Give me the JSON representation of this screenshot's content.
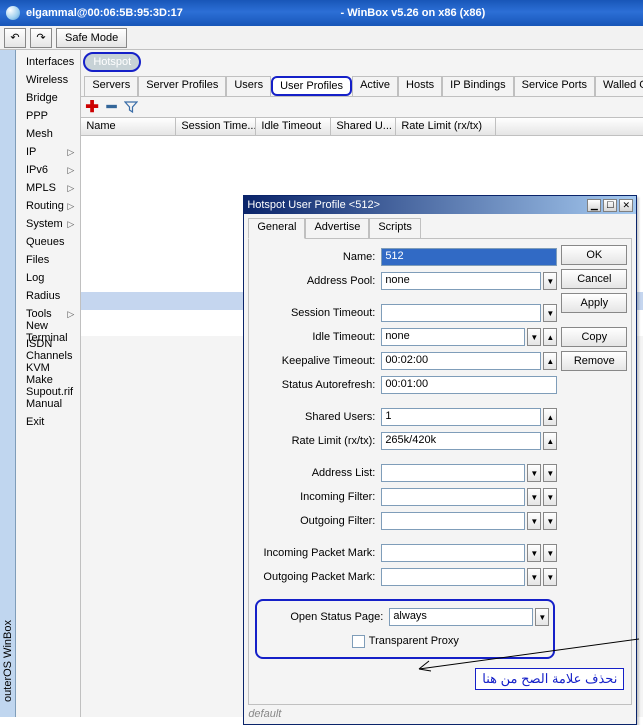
{
  "titlebar": {
    "user": "elgammal@00:06:5B:95:3D:17",
    "app": "- WinBox v5.26 on x86 (x86)"
  },
  "toolbar": {
    "safe_mode": "Safe Mode"
  },
  "side_label": "outerOS WinBox",
  "sidebar": {
    "items": [
      {
        "label": "Interfaces",
        "sub": false
      },
      {
        "label": "Wireless",
        "sub": false
      },
      {
        "label": "Bridge",
        "sub": false
      },
      {
        "label": "PPP",
        "sub": false
      },
      {
        "label": "Mesh",
        "sub": false
      },
      {
        "label": "IP",
        "sub": true
      },
      {
        "label": "IPv6",
        "sub": true
      },
      {
        "label": "MPLS",
        "sub": true
      },
      {
        "label": "Routing",
        "sub": true
      },
      {
        "label": "System",
        "sub": true
      },
      {
        "label": "Queues",
        "sub": false
      },
      {
        "label": "Files",
        "sub": false
      },
      {
        "label": "Log",
        "sub": false
      },
      {
        "label": "Radius",
        "sub": false
      },
      {
        "label": "Tools",
        "sub": true
      },
      {
        "label": "New Terminal",
        "sub": false
      },
      {
        "label": "ISDN Channels",
        "sub": false
      },
      {
        "label": "KVM",
        "sub": false
      },
      {
        "label": "Make Supout.rif",
        "sub": false
      },
      {
        "label": "Manual",
        "sub": false
      },
      {
        "label": "Exit",
        "sub": false
      }
    ]
  },
  "hotspot_tab": "Hotspot",
  "sub_tabs": [
    "Servers",
    "Server Profiles",
    "Users",
    "User Profiles",
    "Active",
    "Hosts",
    "IP Bindings",
    "Service Ports",
    "Walled Ga"
  ],
  "sub_tab_active": 3,
  "grid_cols": [
    "Name",
    "Session Time...",
    "Idle Timeout",
    "Shared U...",
    "Rate Limit (rx/tx)"
  ],
  "dialog": {
    "title": "Hotspot User Profile <512>",
    "tabs": [
      "General",
      "Advertise",
      "Scripts"
    ],
    "buttons": {
      "ok": "OK",
      "cancel": "Cancel",
      "apply": "Apply",
      "copy": "Copy",
      "remove": "Remove"
    },
    "fields": {
      "name_label": "Name:",
      "name": "512",
      "address_pool_label": "Address Pool:",
      "address_pool": "none",
      "session_timeout_label": "Session Timeout:",
      "session_timeout": "",
      "idle_timeout_label": "Idle Timeout:",
      "idle_timeout": "none",
      "keepalive_label": "Keepalive Timeout:",
      "keepalive": "00:02:00",
      "status_autorefresh_label": "Status Autorefresh:",
      "status_autorefresh": "00:01:00",
      "shared_users_label": "Shared Users:",
      "shared_users": "1",
      "rate_limit_label": "Rate Limit (rx/tx):",
      "rate_limit": "265k/420k",
      "address_list_label": "Address List:",
      "address_list": "",
      "incoming_filter_label": "Incoming Filter:",
      "incoming_filter": "",
      "outgoing_filter_label": "Outgoing Filter:",
      "outgoing_filter": "",
      "incoming_packet_mark_label": "Incoming Packet Mark:",
      "incoming_packet_mark": "",
      "outgoing_packet_mark_label": "Outgoing Packet Mark:",
      "outgoing_packet_mark": "",
      "open_status_label": "Open Status Page:",
      "open_status": "always",
      "transparent_proxy_label": "Transparent Proxy"
    },
    "status": "default"
  },
  "arabic_note": "نحذف علامة الصح من هنا"
}
